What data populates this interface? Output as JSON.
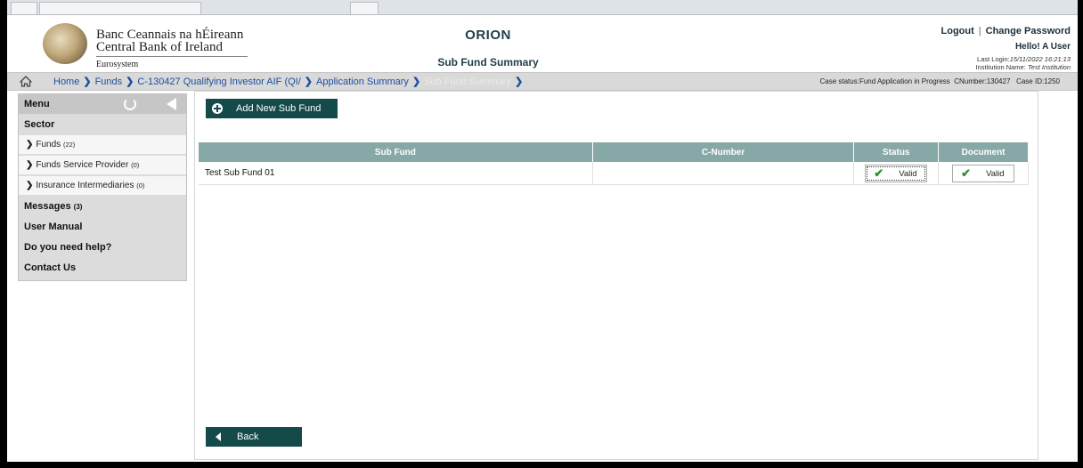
{
  "header": {
    "bank_irish": "Banc Ceannais na hÉireann",
    "bank_english": "Central Bank of Ireland",
    "bank_eurosystem": "Eurosystem",
    "app_name": "ORION",
    "page_title": "Sub Fund Summary",
    "logout_label": "Logout",
    "separator": "|",
    "change_password_label": "Change Password",
    "greeting": "Hello! A User",
    "last_login_label": "Last Login:",
    "last_login_value": "15/11/2022 16:21:13",
    "institution_label": "Institution Name:",
    "institution_value": "Test Institution"
  },
  "breadcrumb": {
    "items": [
      "Home",
      "Funds",
      "C-130427 Qualifying Investor AIF (QI/",
      "Application Summary",
      "Sub Fund Summary"
    ],
    "case_status": "Case status:Fund Application in Progress",
    "cnumber": "CNumber:130427",
    "case_id": "Case ID:1250"
  },
  "sidebar": {
    "menu_label": "Menu",
    "sector_label": "Sector",
    "sub_items": [
      {
        "label": "Funds",
        "count": "(22)"
      },
      {
        "label": "Funds Service Provider",
        "count": "(0)"
      },
      {
        "label": "Insurance Intermediaries",
        "count": "(0)"
      }
    ],
    "messages_label": "Messages",
    "messages_count": "(3)",
    "user_manual": "User Manual",
    "help": "Do you need help?",
    "contact": "Contact Us"
  },
  "main": {
    "add_button": "Add New Sub Fund",
    "back_button": "Back",
    "table": {
      "headers": [
        "Sub Fund",
        "C-Number",
        "Status",
        "Document"
      ],
      "rows": [
        {
          "sub_fund": "Test Sub Fund 01",
          "c_number": "",
          "status": "Valid",
          "document": "Valid"
        }
      ]
    }
  },
  "colors": {
    "accent_dark": "#154a4a",
    "table_header": "#86a8a6",
    "link_blue": "#1e4fa0",
    "valid_check": "#2f8f2f"
  },
  "icons": [
    "home-icon",
    "refresh-icon",
    "collapse-icon",
    "add-icon",
    "chevron-right-icon",
    "check-icon",
    "back-arrow-icon",
    "logo-seal"
  ]
}
